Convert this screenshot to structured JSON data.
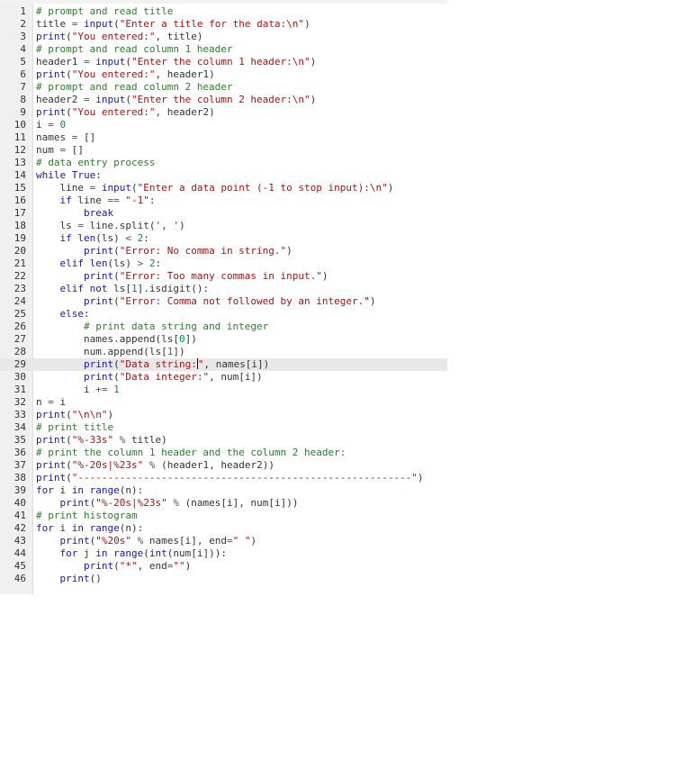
{
  "editor": {
    "active_line": 29,
    "cursor_line": 29,
    "lines": [
      [
        [
          "cm",
          "# prompt and read title"
        ]
      ],
      [
        [
          "pl",
          "title "
        ],
        [
          "op",
          "="
        ],
        [
          "pl",
          " "
        ],
        [
          "bi",
          "input"
        ],
        [
          "pl",
          "("
        ],
        [
          "st",
          "\"Enter a title for the data:\\n\""
        ],
        [
          "pl",
          ")"
        ]
      ],
      [
        [
          "bi",
          "print"
        ],
        [
          "pl",
          "("
        ],
        [
          "st",
          "\"You entered:\""
        ],
        [
          "pl",
          ", title)"
        ]
      ],
      [
        [
          "cm",
          "# prompt and read column 1 header"
        ]
      ],
      [
        [
          "pl",
          "header1 "
        ],
        [
          "op",
          "="
        ],
        [
          "pl",
          " "
        ],
        [
          "bi",
          "input"
        ],
        [
          "pl",
          "("
        ],
        [
          "st",
          "\"Enter the column 1 header:\\n\""
        ],
        [
          "pl",
          ")"
        ]
      ],
      [
        [
          "bi",
          "print"
        ],
        [
          "pl",
          "("
        ],
        [
          "st",
          "\"You entered:\""
        ],
        [
          "pl",
          ", header1)"
        ]
      ],
      [
        [
          "cm",
          "# prompt and read column 2 header"
        ]
      ],
      [
        [
          "pl",
          "header2 "
        ],
        [
          "op",
          "="
        ],
        [
          "pl",
          " "
        ],
        [
          "bi",
          "input"
        ],
        [
          "pl",
          "("
        ],
        [
          "st",
          "\"Enter the column 2 header:\\n\""
        ],
        [
          "pl",
          ")"
        ]
      ],
      [
        [
          "bi",
          "print"
        ],
        [
          "pl",
          "("
        ],
        [
          "st",
          "\"You entered:\""
        ],
        [
          "pl",
          ", header2)"
        ]
      ],
      [
        [
          "pl",
          "i "
        ],
        [
          "op",
          "="
        ],
        [
          "pl",
          " "
        ],
        [
          "nm",
          "0"
        ]
      ],
      [
        [
          "pl",
          "names "
        ],
        [
          "op",
          "="
        ],
        [
          "pl",
          " []"
        ]
      ],
      [
        [
          "pl",
          "num "
        ],
        [
          "op",
          "="
        ],
        [
          "pl",
          " []"
        ]
      ],
      [
        [
          "cm",
          "# data entry process"
        ]
      ],
      [
        [
          "kw",
          "while"
        ],
        [
          "pl",
          " "
        ],
        [
          "kw",
          "True"
        ],
        [
          "pl",
          ":"
        ]
      ],
      [
        [
          "pl",
          "    line "
        ],
        [
          "op",
          "="
        ],
        [
          "pl",
          " "
        ],
        [
          "bi",
          "input"
        ],
        [
          "pl",
          "("
        ],
        [
          "st",
          "\"Enter a data point (-1 to stop input):\\n\""
        ],
        [
          "pl",
          ")"
        ]
      ],
      [
        [
          "pl",
          "    "
        ],
        [
          "kw",
          "if"
        ],
        [
          "pl",
          " line "
        ],
        [
          "op",
          "=="
        ],
        [
          "pl",
          " "
        ],
        [
          "st",
          "\"-1\""
        ],
        [
          "pl",
          ":"
        ]
      ],
      [
        [
          "pl",
          "        "
        ],
        [
          "kw",
          "break"
        ]
      ],
      [
        [
          "pl",
          "    ls "
        ],
        [
          "op",
          "="
        ],
        [
          "pl",
          " line.split("
        ],
        [
          "st",
          "', '"
        ],
        [
          "pl",
          ")"
        ]
      ],
      [
        [
          "pl",
          "    "
        ],
        [
          "kw",
          "if"
        ],
        [
          "pl",
          " "
        ],
        [
          "bi",
          "len"
        ],
        [
          "pl",
          "(ls) "
        ],
        [
          "op",
          "<"
        ],
        [
          "pl",
          " "
        ],
        [
          "nm",
          "2"
        ],
        [
          "pl",
          ":"
        ]
      ],
      [
        [
          "pl",
          "        "
        ],
        [
          "bi",
          "print"
        ],
        [
          "pl",
          "("
        ],
        [
          "st",
          "\"Error: No comma in string.\""
        ],
        [
          "pl",
          ")"
        ]
      ],
      [
        [
          "pl",
          "    "
        ],
        [
          "kw",
          "elif"
        ],
        [
          "pl",
          " "
        ],
        [
          "bi",
          "len"
        ],
        [
          "pl",
          "(ls) "
        ],
        [
          "op",
          ">"
        ],
        [
          "pl",
          " "
        ],
        [
          "nm",
          "2"
        ],
        [
          "pl",
          ":"
        ]
      ],
      [
        [
          "pl",
          "        "
        ],
        [
          "bi",
          "print"
        ],
        [
          "pl",
          "("
        ],
        [
          "st",
          "\"Error: Too many commas in input.\""
        ],
        [
          "pl",
          ")"
        ]
      ],
      [
        [
          "pl",
          "    "
        ],
        [
          "kw",
          "elif"
        ],
        [
          "pl",
          " "
        ],
        [
          "kw",
          "not"
        ],
        [
          "pl",
          " ls["
        ],
        [
          "nm",
          "1"
        ],
        [
          "pl",
          "].isdigit():"
        ]
      ],
      [
        [
          "pl",
          "        "
        ],
        [
          "bi",
          "print"
        ],
        [
          "pl",
          "("
        ],
        [
          "st",
          "\"Error: Comma not followed by an integer.\""
        ],
        [
          "pl",
          ")"
        ]
      ],
      [
        [
          "pl",
          "    "
        ],
        [
          "kw",
          "else"
        ],
        [
          "pl",
          ":"
        ]
      ],
      [
        [
          "pl",
          "        "
        ],
        [
          "cm",
          "# print data string and integer"
        ]
      ],
      [
        [
          "pl",
          "        names.append(ls["
        ],
        [
          "nm",
          "0"
        ],
        [
          "pl",
          "])"
        ]
      ],
      [
        [
          "pl",
          "        num.append(ls["
        ],
        [
          "nm",
          "1"
        ],
        [
          "pl",
          "])"
        ]
      ],
      [
        [
          "pl",
          "        "
        ],
        [
          "bi",
          "print"
        ],
        [
          "pl",
          "("
        ],
        [
          "st",
          "\"Data string:"
        ],
        [
          "cur",
          ""
        ],
        [
          "st",
          "\""
        ],
        [
          "pl",
          ", names[i])"
        ]
      ],
      [
        [
          "pl",
          "        "
        ],
        [
          "bi",
          "print"
        ],
        [
          "pl",
          "("
        ],
        [
          "st",
          "\"Data integer:\""
        ],
        [
          "pl",
          ", num[i])"
        ]
      ],
      [
        [
          "pl",
          "        i "
        ],
        [
          "op",
          "+="
        ],
        [
          "pl",
          " "
        ],
        [
          "nm",
          "1"
        ]
      ],
      [
        [
          "pl",
          "n "
        ],
        [
          "op",
          "="
        ],
        [
          "pl",
          " i"
        ]
      ],
      [
        [
          "bi",
          "print"
        ],
        [
          "pl",
          "("
        ],
        [
          "st",
          "\"\\n\\n\""
        ],
        [
          "pl",
          ")"
        ]
      ],
      [
        [
          "cm",
          "# print title"
        ]
      ],
      [
        [
          "bi",
          "print"
        ],
        [
          "pl",
          "("
        ],
        [
          "st",
          "\"%-33s\""
        ],
        [
          "pl",
          " "
        ],
        [
          "op",
          "%"
        ],
        [
          "pl",
          " title)"
        ]
      ],
      [
        [
          "cm",
          "# print the column 1 header and the column 2 header:"
        ]
      ],
      [
        [
          "bi",
          "print"
        ],
        [
          "pl",
          "("
        ],
        [
          "st",
          "\"%-20s|%23s\""
        ],
        [
          "pl",
          " "
        ],
        [
          "op",
          "%"
        ],
        [
          "pl",
          " (header1, header2))"
        ]
      ],
      [
        [
          "bi",
          "print"
        ],
        [
          "pl",
          "("
        ],
        [
          "st",
          "\"--------------------------------------------------------\""
        ],
        [
          "pl",
          ")"
        ]
      ],
      [
        [
          "kw",
          "for"
        ],
        [
          "pl",
          " i "
        ],
        [
          "kw",
          "in"
        ],
        [
          "pl",
          " "
        ],
        [
          "bi",
          "range"
        ],
        [
          "pl",
          "(n):"
        ]
      ],
      [
        [
          "pl",
          "    "
        ],
        [
          "bi",
          "print"
        ],
        [
          "pl",
          "("
        ],
        [
          "st",
          "\"%-20s|%23s\""
        ],
        [
          "pl",
          " "
        ],
        [
          "op",
          "%"
        ],
        [
          "pl",
          " (names[i], num[i]))"
        ]
      ],
      [
        [
          "cm",
          "# print histogram"
        ]
      ],
      [
        [
          "kw",
          "for"
        ],
        [
          "pl",
          " i "
        ],
        [
          "kw",
          "in"
        ],
        [
          "pl",
          " "
        ],
        [
          "bi",
          "range"
        ],
        [
          "pl",
          "(n):"
        ]
      ],
      [
        [
          "pl",
          "    "
        ],
        [
          "bi",
          "print"
        ],
        [
          "pl",
          "("
        ],
        [
          "st",
          "\"%20s\""
        ],
        [
          "pl",
          " "
        ],
        [
          "op",
          "%"
        ],
        [
          "pl",
          " names[i], end"
        ],
        [
          "op",
          "="
        ],
        [
          "st",
          "\" \""
        ],
        [
          "pl",
          ")"
        ]
      ],
      [
        [
          "pl",
          "    "
        ],
        [
          "kw",
          "for"
        ],
        [
          "pl",
          " j "
        ],
        [
          "kw",
          "in"
        ],
        [
          "pl",
          " "
        ],
        [
          "bi",
          "range"
        ],
        [
          "pl",
          "("
        ],
        [
          "bi",
          "int"
        ],
        [
          "pl",
          "(num[i])):"
        ]
      ],
      [
        [
          "pl",
          "        "
        ],
        [
          "bi",
          "print"
        ],
        [
          "pl",
          "("
        ],
        [
          "st",
          "\"*\""
        ],
        [
          "pl",
          ", end"
        ],
        [
          "op",
          "="
        ],
        [
          "st",
          "\"\""
        ],
        [
          "pl",
          ")"
        ]
      ],
      [
        [
          "pl",
          "    "
        ],
        [
          "bi",
          "print"
        ],
        [
          "pl",
          "()"
        ]
      ]
    ]
  }
}
